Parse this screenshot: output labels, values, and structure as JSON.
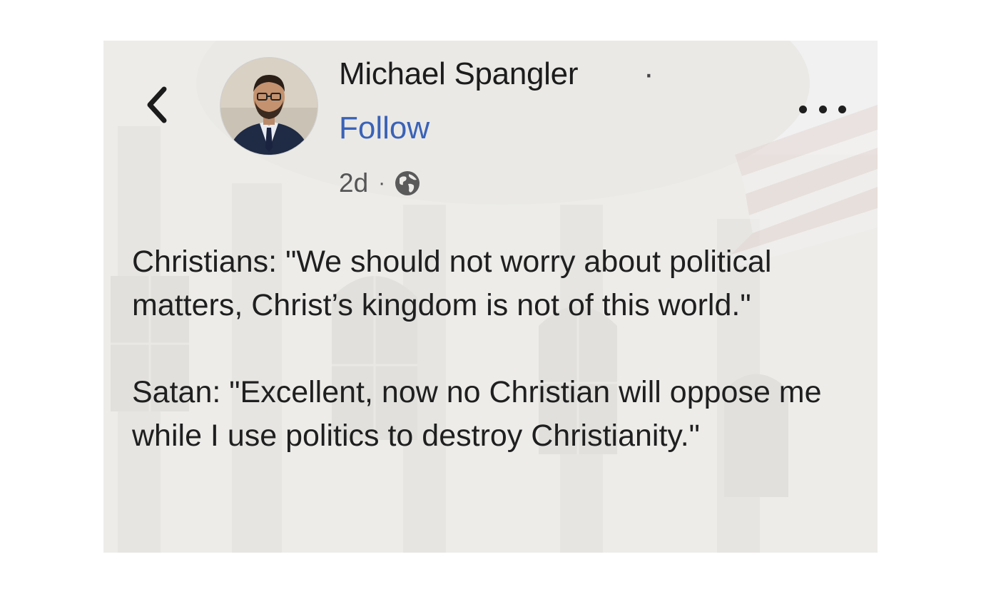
{
  "post": {
    "author": {
      "name": "Michael Spangler",
      "separator": "·",
      "follow_label": "Follow"
    },
    "meta": {
      "time": "2d",
      "separator": "·",
      "privacy_icon": "globe-icon"
    },
    "paragraphs": [
      "Christians: \"We should not worry about political matters, Christ’s kingdom is not of this world.\"",
      "Satan: \"Excellent, now no Christian will oppose me while I use politics to destroy Christianity.\""
    ],
    "icons": {
      "back": "chevron-left-icon",
      "more": "more-horizontal-icon"
    },
    "colors": {
      "follow_link": "#3a62b7",
      "text": "#1f1f1f",
      "background": "#ecebe8"
    }
  }
}
